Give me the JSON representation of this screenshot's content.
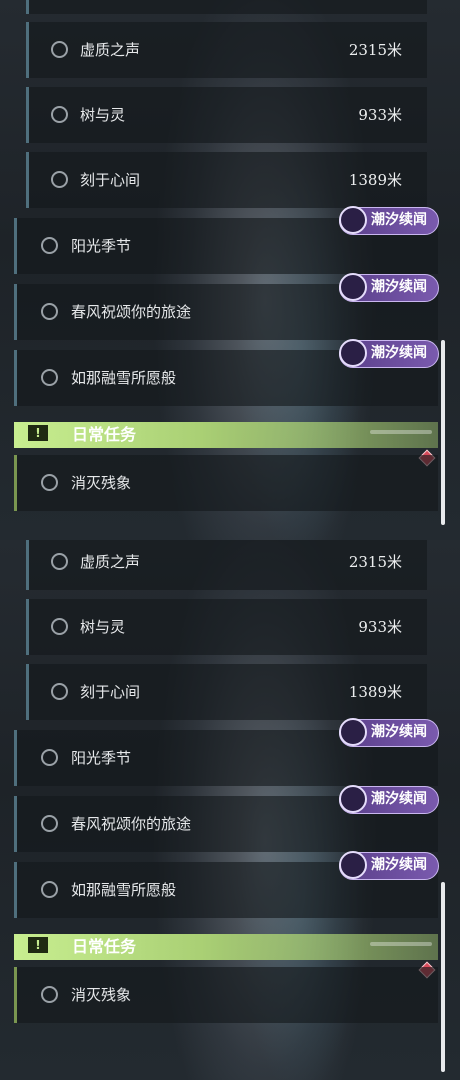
{
  "panels": [
    {
      "sub_quests": [
        {
          "label": "虚质之声",
          "distance": "2315米"
        },
        {
          "label": "树与灵",
          "distance": "933米"
        },
        {
          "label": "刻于心间",
          "distance": "1389米"
        }
      ],
      "main_quests": [
        {
          "label": "阳光季节",
          "badge": "潮汐续闻"
        },
        {
          "label": "春风祝颂你的旅途",
          "badge": "潮汐续闻"
        },
        {
          "label": "如那融雪所愿般",
          "badge": "潮汐续闻"
        }
      ],
      "category": {
        "label": "日常任务",
        "icon": "exclamation-box-icon"
      },
      "daily_quests": [
        {
          "label": "消灭残象"
        }
      ]
    },
    {
      "sub_quests": [
        {
          "label": "虚质之声",
          "distance": "2315米"
        },
        {
          "label": "树与灵",
          "distance": "933米"
        },
        {
          "label": "刻于心间",
          "distance": "1389米"
        }
      ],
      "main_quests": [
        {
          "label": "阳光季节",
          "badge": "潮汐续闻"
        },
        {
          "label": "春风祝颂你的旅途",
          "badge": "潮汐续闻"
        },
        {
          "label": "如那融雪所愿般",
          "badge": "潮汐续闻"
        }
      ],
      "category": {
        "label": "日常任务",
        "icon": "exclamation-box-icon"
      },
      "daily_quests": [
        {
          "label": "消灭残象"
        }
      ]
    }
  ],
  "colors": {
    "category_green": "#c8ee90",
    "badge_purple": "#6a4c9c",
    "marker_red": "#d84a5a",
    "row_accent": "#4f6f7d"
  }
}
